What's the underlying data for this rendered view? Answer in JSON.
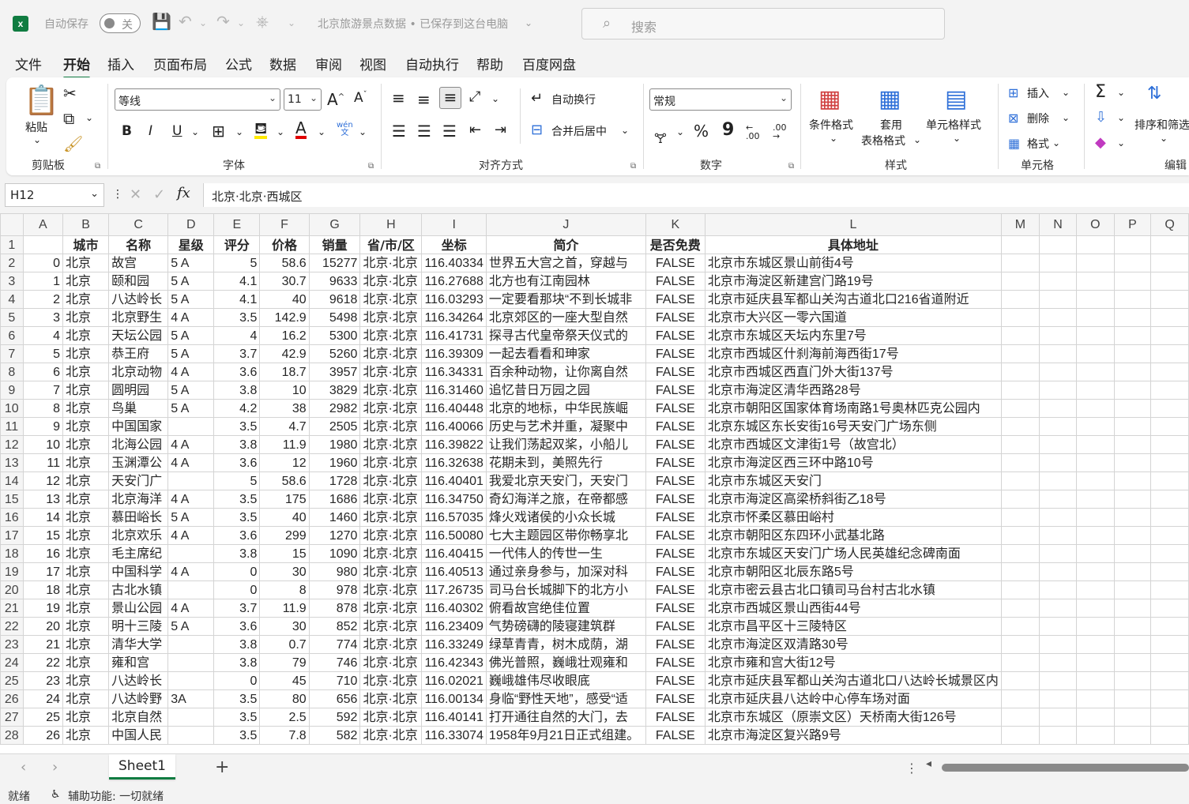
{
  "titlebar": {
    "autosave_label": "自动保存",
    "autosave_state": "关",
    "doc_title": "北京旅游景点数据 • 已保存到这台电脑",
    "search_placeholder": "搜索"
  },
  "menu": [
    "文件",
    "开始",
    "插入",
    "页面布局",
    "公式",
    "数据",
    "审阅",
    "视图",
    "自动执行",
    "帮助",
    "百度网盘"
  ],
  "ribbon": {
    "clipboard": {
      "paste": "粘贴",
      "label": "剪贴板"
    },
    "font": {
      "name": "等线",
      "size": "11",
      "bold": "B",
      "italic": "I",
      "underline": "U",
      "wen": "wén",
      "wen_sub": "文",
      "label": "字体",
      "grow": "A",
      "shrink": "A"
    },
    "align": {
      "wrap": "自动换行",
      "merge": "合并后居中",
      "label": "对齐方式"
    },
    "number": {
      "format": "常规",
      "percent": "%",
      "comma": "9",
      "inc": ".00",
      "dec": ".00",
      "label": "数字"
    },
    "styles": {
      "cond": "条件格式",
      "table1": "套用",
      "table2": "表格格式",
      "cell": "单元格样式",
      "label": "样式"
    },
    "cells": {
      "insert": "插入",
      "delete": "删除",
      "format": "格式",
      "label": "单元格"
    },
    "editing": {
      "sort": "排序和筛选",
      "label": "编辑",
      "sum": "Σ"
    }
  },
  "formula_bar": {
    "cell_ref": "H12",
    "fx": "fx",
    "value": "北京·北京·西城区"
  },
  "columns": [
    "A",
    "B",
    "C",
    "D",
    "E",
    "F",
    "G",
    "H",
    "I",
    "J",
    "K",
    "L",
    "M",
    "N",
    "O",
    "P",
    "Q"
  ],
  "header_row": [
    "",
    "城市",
    "名称",
    "星级",
    "评分",
    "价格",
    "销量",
    "省/市/区",
    "坐标",
    "简介",
    "是否免费",
    "具体地址"
  ],
  "rows": [
    [
      "0",
      "北京",
      "故宫",
      "5 A",
      "5",
      "58.6",
      "15277",
      "北京·北京",
      "116.40334",
      "世界五大宫之首，穿越与",
      "FALSE",
      "北京市东城区景山前街4号"
    ],
    [
      "1",
      "北京",
      "颐和园",
      "5 A",
      "4.1",
      "30.7",
      "9633",
      "北京·北京",
      "116.27688",
      "北方也有江南园林",
      "FALSE",
      "北京市海淀区新建宫门路19号"
    ],
    [
      "2",
      "北京",
      "八达岭长",
      "5 A",
      "4.1",
      "40",
      "9618",
      "北京·北京",
      "116.03293",
      "一定要看那块“不到长城非",
      "FALSE",
      "北京市延庆县军都山关沟古道北口216省道附近"
    ],
    [
      "3",
      "北京",
      "北京野生",
      "4 A",
      "3.5",
      "142.9",
      "5498",
      "北京·北京",
      "116.34264",
      "北京郊区的一座大型自然",
      "FALSE",
      "北京市大兴区一零六国道"
    ],
    [
      "4",
      "北京",
      "天坛公园",
      "5 A",
      "4",
      "16.2",
      "5300",
      "北京·北京",
      "116.41731",
      "探寻古代皇帝祭天仪式的",
      "FALSE",
      "北京市东城区天坛内东里7号"
    ],
    [
      "5",
      "北京",
      "恭王府",
      "5 A",
      "3.7",
      "42.9",
      "5260",
      "北京·北京",
      "116.39309",
      "一起去看看和珅家",
      "FALSE",
      "北京市西城区什刹海前海西街17号"
    ],
    [
      "6",
      "北京",
      "北京动物",
      "4 A",
      "3.6",
      "18.7",
      "3957",
      "北京·北京",
      "116.34331",
      "百余种动物，让你离自然",
      "FALSE",
      "北京市西城区西直门外大街137号"
    ],
    [
      "7",
      "北京",
      "圆明园",
      "5 A",
      "3.8",
      "10",
      "3829",
      "北京·北京",
      "116.31460",
      "追忆昔日万园之园",
      "FALSE",
      "北京市海淀区清华西路28号"
    ],
    [
      "8",
      "北京",
      "鸟巢",
      "5 A",
      "4.2",
      "38",
      "2982",
      "北京·北京",
      "116.40448",
      "北京的地标，中华民族崛",
      "FALSE",
      "北京市朝阳区国家体育场南路1号奥林匹克公园内"
    ],
    [
      "9",
      "北京",
      "中国国家",
      "",
      "3.5",
      "4.7",
      "2505",
      "北京·北京",
      "116.40066",
      "历史与艺术并重，凝聚中",
      "FALSE",
      "北京东城区东长安街16号天安门广场东侧"
    ],
    [
      "10",
      "北京",
      "北海公园",
      "4 A",
      "3.8",
      "11.9",
      "1980",
      "北京·北京",
      "116.39822",
      "让我们荡起双桨，小船儿",
      "FALSE",
      "北京市西城区文津街1号（故宫北）"
    ],
    [
      "11",
      "北京",
      "玉渊潭公",
      "4 A",
      "3.6",
      "12",
      "1960",
      "北京·北京",
      "116.32638",
      "花期未到，美照先行",
      "FALSE",
      "北京市海淀区西三环中路10号"
    ],
    [
      "12",
      "北京",
      "天安门广",
      "",
      "5",
      "58.6",
      "1728",
      "北京·北京",
      "116.40401",
      "我爱北京天安门，天安门",
      "FALSE",
      "北京市东城区天安门"
    ],
    [
      "13",
      "北京",
      "北京海洋",
      "4 A",
      "3.5",
      "175",
      "1686",
      "北京·北京",
      "116.34750",
      "奇幻海洋之旅，在帝都感",
      "FALSE",
      "北京市海淀区高梁桥斜街乙18号"
    ],
    [
      "14",
      "北京",
      "慕田峪长",
      "5 A",
      "3.5",
      "40",
      "1460",
      "北京·北京",
      "116.57035",
      "烽火戏诸侯的小众长城",
      "FALSE",
      "北京市怀柔区慕田峪村"
    ],
    [
      "15",
      "北京",
      "北京欢乐",
      "4 A",
      "3.6",
      "299",
      "1270",
      "北京·北京",
      "116.50080",
      "七大主题园区带你畅享北",
      "FALSE",
      "北京市朝阳区东四环小武基北路"
    ],
    [
      "16",
      "北京",
      "毛主席纪",
      "",
      "3.8",
      "15",
      "1090",
      "北京·北京",
      "116.40415",
      "一代伟人的传世一生",
      "FALSE",
      "北京市东城区天安门广场人民英雄纪念碑南面"
    ],
    [
      "17",
      "北京",
      "中国科学",
      "4 A",
      "0",
      "30",
      "980",
      "北京·北京",
      "116.40513",
      "通过亲身参与，加深对科",
      "FALSE",
      "北京市朝阳区北辰东路5号"
    ],
    [
      "18",
      "北京",
      "古北水镇",
      "",
      "0",
      "8",
      "978",
      "北京·北京",
      "117.26735",
      "司马台长城脚下的北方小",
      "FALSE",
      "北京市密云县古北口镇司马台村古北水镇"
    ],
    [
      "19",
      "北京",
      "景山公园",
      "4 A",
      "3.7",
      "11.9",
      "878",
      "北京·北京",
      "116.40302",
      "俯看故宫绝佳位置",
      "FALSE",
      "北京市西城区景山西街44号"
    ],
    [
      "20",
      "北京",
      "明十三陵",
      "5 A",
      "3.6",
      "30",
      "852",
      "北京·北京",
      "116.23409",
      "气势磅礴的陵寝建筑群",
      "FALSE",
      "北京市昌平区十三陵特区"
    ],
    [
      "21",
      "北京",
      "清华大学",
      "",
      "3.8",
      "0.7",
      "774",
      "北京·北京",
      "116.33249",
      "绿草青青，树木成荫，湖",
      "FALSE",
      "北京市海淀区双清路30号"
    ],
    [
      "22",
      "北京",
      "雍和宫",
      "",
      "3.8",
      "79",
      "746",
      "北京·北京",
      "116.42343",
      "佛光普照，巍峨壮观雍和",
      "FALSE",
      "北京市雍和宫大街12号"
    ],
    [
      "23",
      "北京",
      "八达岭长",
      "",
      "0",
      "45",
      "710",
      "北京·北京",
      "116.02021",
      "巍峨雄伟尽收眼底",
      "FALSE",
      "北京市延庆县军都山关沟古道北口八达岭长城景区内"
    ],
    [
      "24",
      "北京",
      "八达岭野",
      "3A",
      "3.5",
      "80",
      "656",
      "北京·北京",
      "116.00134",
      "身临“野性天地”，感受“适",
      "FALSE",
      "北京市延庆县八达岭中心停车场对面"
    ],
    [
      "25",
      "北京",
      "北京自然",
      "",
      "3.5",
      "2.5",
      "592",
      "北京·北京",
      "116.40141",
      "打开通往自然的大门，去",
      "FALSE",
      "北京市东城区（原崇文区）天桥南大街126号"
    ],
    [
      "26",
      "北京",
      "中国人民",
      "",
      "3.5",
      "7.8",
      "582",
      "北京·北京",
      "116.33074",
      "1958年9月21日正式组建。",
      "FALSE",
      "北京市海淀区复兴路9号"
    ]
  ],
  "tabs": {
    "sheet": "Sheet1",
    "add": "+"
  },
  "status": {
    "ready": "就绪",
    "accessibility": "辅助功能: 一切就绪"
  }
}
